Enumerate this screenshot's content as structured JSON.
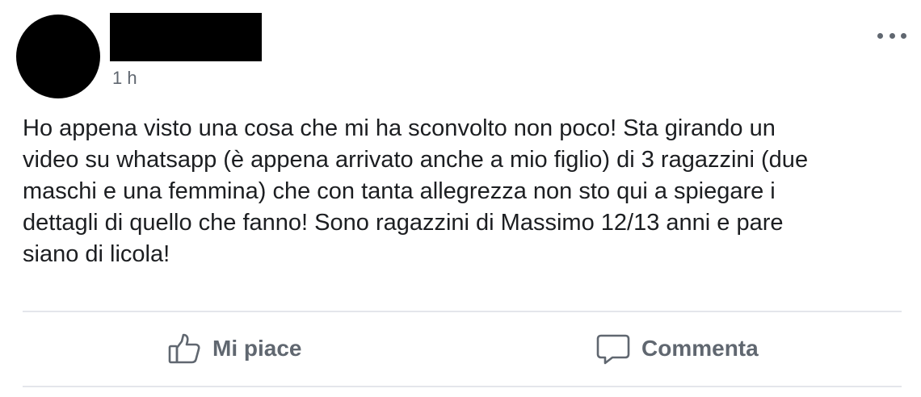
{
  "post": {
    "timestamp": "1 h",
    "text": "Ho appena visto una cosa che mi ha sconvolto non poco! Sta girando un\nvideo su whatsapp (è appena arrivato anche a mio figlio) di 3 ragazzini (due\nmaschi e una femmina) che con tanta allegrezza non sto qui a spiegare i\ndettagli di quello che fanno! Sono ragazzini di Massimo 12/13 anni e pare\nsiano di licola!"
  },
  "actions": {
    "like_label": "Mi piace",
    "like_icon": "thumbs-up-icon",
    "comment_label": "Commenta",
    "comment_icon": "comment-bubble-icon"
  },
  "icons": {
    "more": "more-options-icon"
  },
  "colors": {
    "text": "#1c1e21",
    "secondary_text": "#606770",
    "divider": "#e4e6eb",
    "redaction": "#000000"
  }
}
